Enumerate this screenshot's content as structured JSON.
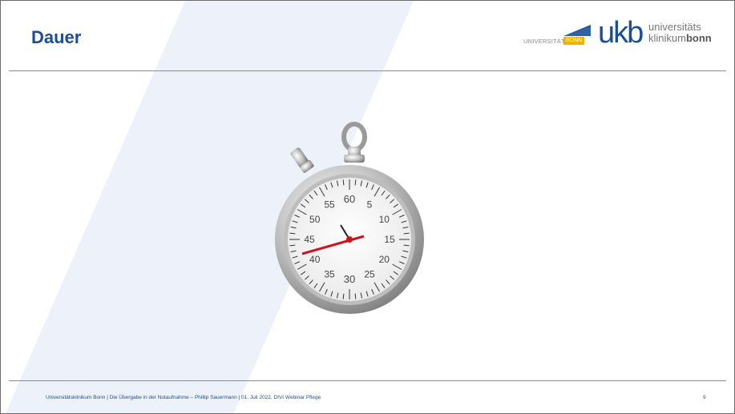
{
  "slide": {
    "title": "Dauer",
    "footer": "Universitätsklinikum Bonn | Die Übergabe in der Notaufnahme – Phillip Sauermann | 01. Juli  2022, DIVI Webinar Pflege",
    "page_number": "9"
  },
  "logos": {
    "uni_text": "UNIVERSITÄT",
    "uni_box": "BONN",
    "ukb_mark": "ukb",
    "ukb_line1": "universitäts",
    "ukb_line2_a": "klinikum",
    "ukb_line2_b": "bonn"
  },
  "stopwatch": {
    "labels": [
      "60",
      "5",
      "10",
      "15",
      "20",
      "25",
      "30",
      "35",
      "40",
      "45",
      "50",
      "55"
    ]
  },
  "colors": {
    "title": "#1c4e95",
    "brand_yellow": "#f2b200",
    "hand": "#d0131b"
  }
}
